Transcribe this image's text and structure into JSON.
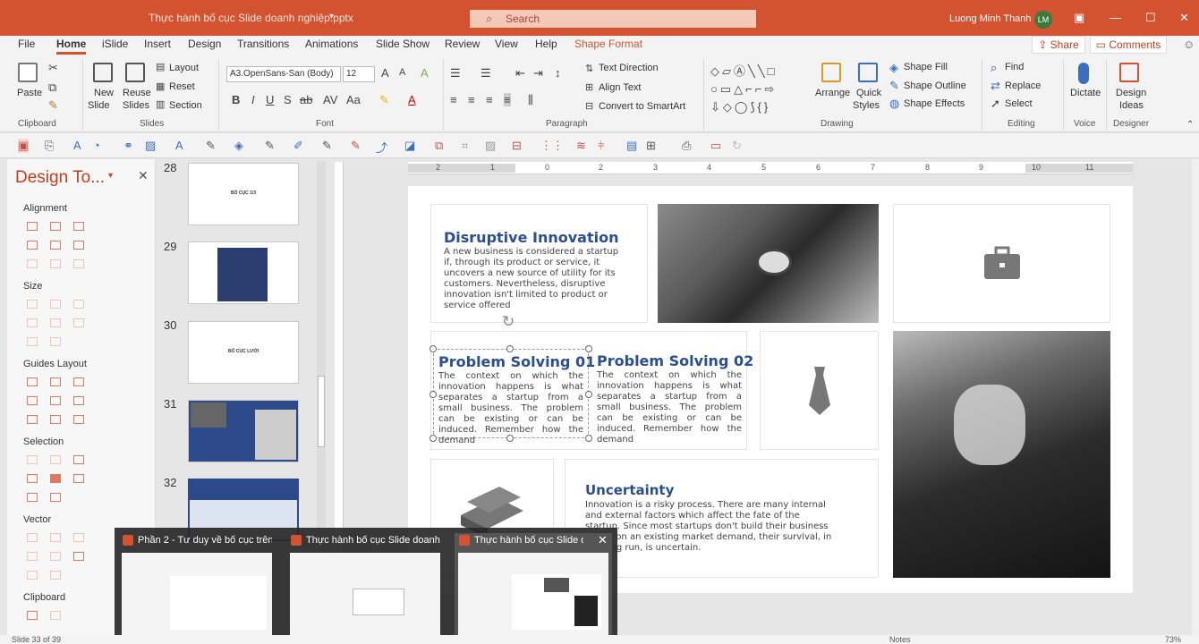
{
  "title_bar": {
    "file_title": "Thực hành bố cục Slide doanh nghiệp.pptx",
    "search_placeholder": "Search",
    "user_name": "Luong Minh Thanh",
    "user_initials": "LM"
  },
  "tabs": [
    "File",
    "Home",
    "iSlide",
    "Insert",
    "Design",
    "Transitions",
    "Animations",
    "Slide Show",
    "Review",
    "View",
    "Help",
    "Shape Format"
  ],
  "share_label": "Share",
  "comments_label": "Comments",
  "ribbon": {
    "clipboard": {
      "paste": "Paste",
      "group": "Clipboard"
    },
    "slides": {
      "new_slide": "New",
      "new_slide2": "Slide",
      "reuse": "Reuse",
      "reuse2": "Slides",
      "layout": "Layout",
      "reset": "Reset",
      "section": "Section",
      "group": "Slides"
    },
    "font": {
      "family": "A3.OpenSans-San (Body)",
      "size": "12",
      "group": "Font"
    },
    "paragraph": {
      "text_direction": "Text Direction",
      "align_text": "Align Text",
      "convert": "Convert to SmartArt",
      "group": "Paragraph"
    },
    "drawing": {
      "arrange": "Arrange",
      "quick": "Quick",
      "styles": "Styles",
      "fill": "Shape Fill",
      "outline": "Shape Outline",
      "effects": "Shape Effects",
      "group": "Drawing"
    },
    "editing": {
      "find": "Find",
      "replace": "Replace",
      "select": "Select",
      "group": "Editing"
    },
    "voice": {
      "dictate": "Dictate",
      "group": "Voice"
    },
    "designer": {
      "ideas": "Design",
      "ideas2": "Ideas",
      "group": "Designer"
    }
  },
  "pane": {
    "title": "Design To...",
    "sections": [
      "Alignment",
      "Size",
      "Guides Layout",
      "Selection",
      "Vector",
      "Clipboard"
    ]
  },
  "thumbnails": [
    {
      "num": "28",
      "caption": "BỐ CỤC 1/3"
    },
    {
      "num": "29",
      "caption": ""
    },
    {
      "num": "30",
      "caption": "BỐ CỤC LƯỚI"
    },
    {
      "num": "31",
      "caption": ""
    },
    {
      "num": "32",
      "caption": ""
    }
  ],
  "ruler": [
    "2",
    "1",
    "0",
    "1",
    "2",
    "3",
    "4",
    "5",
    "6",
    "7",
    "8",
    "9",
    "10",
    "11",
    "12"
  ],
  "slide": {
    "disruptive_title": "Disruptive Innovation",
    "disruptive_body": "A new business is considered a startup if, through its product or service, it uncovers a new source of utility for its customers. Nevertheless, disruptive innovation isn't limited to product or service offered",
    "ps1_title": "Problem Solving 01",
    "ps1_body": "The context on which the innovation happens is what separates a startup from a small business. The problem can be existing or can be induced. Remember how the demand",
    "ps2_title": "Problem Solving 02",
    "ps2_body": "The context on which the innovation happens is what separates a startup from a small business. The problem can be existing or can be induced. Remember how the demand",
    "unc_title": "Uncertainty",
    "unc_body": "Innovation is a risky process. There are many internal and external factors which affect the fate of the startup. Since most startups don't build their business model on an existing market demand, their survival, in the long run, is uncertain."
  },
  "previews": [
    "Phần 2 - Tư duy về bố cục trên ...",
    "Thực hành bố cục Slide doanh ...",
    "Thực hành bố cục Slide d..."
  ],
  "status": {
    "slide": "Slide 33 of 39",
    "notes": "Notes",
    "zoom": "73%"
  }
}
